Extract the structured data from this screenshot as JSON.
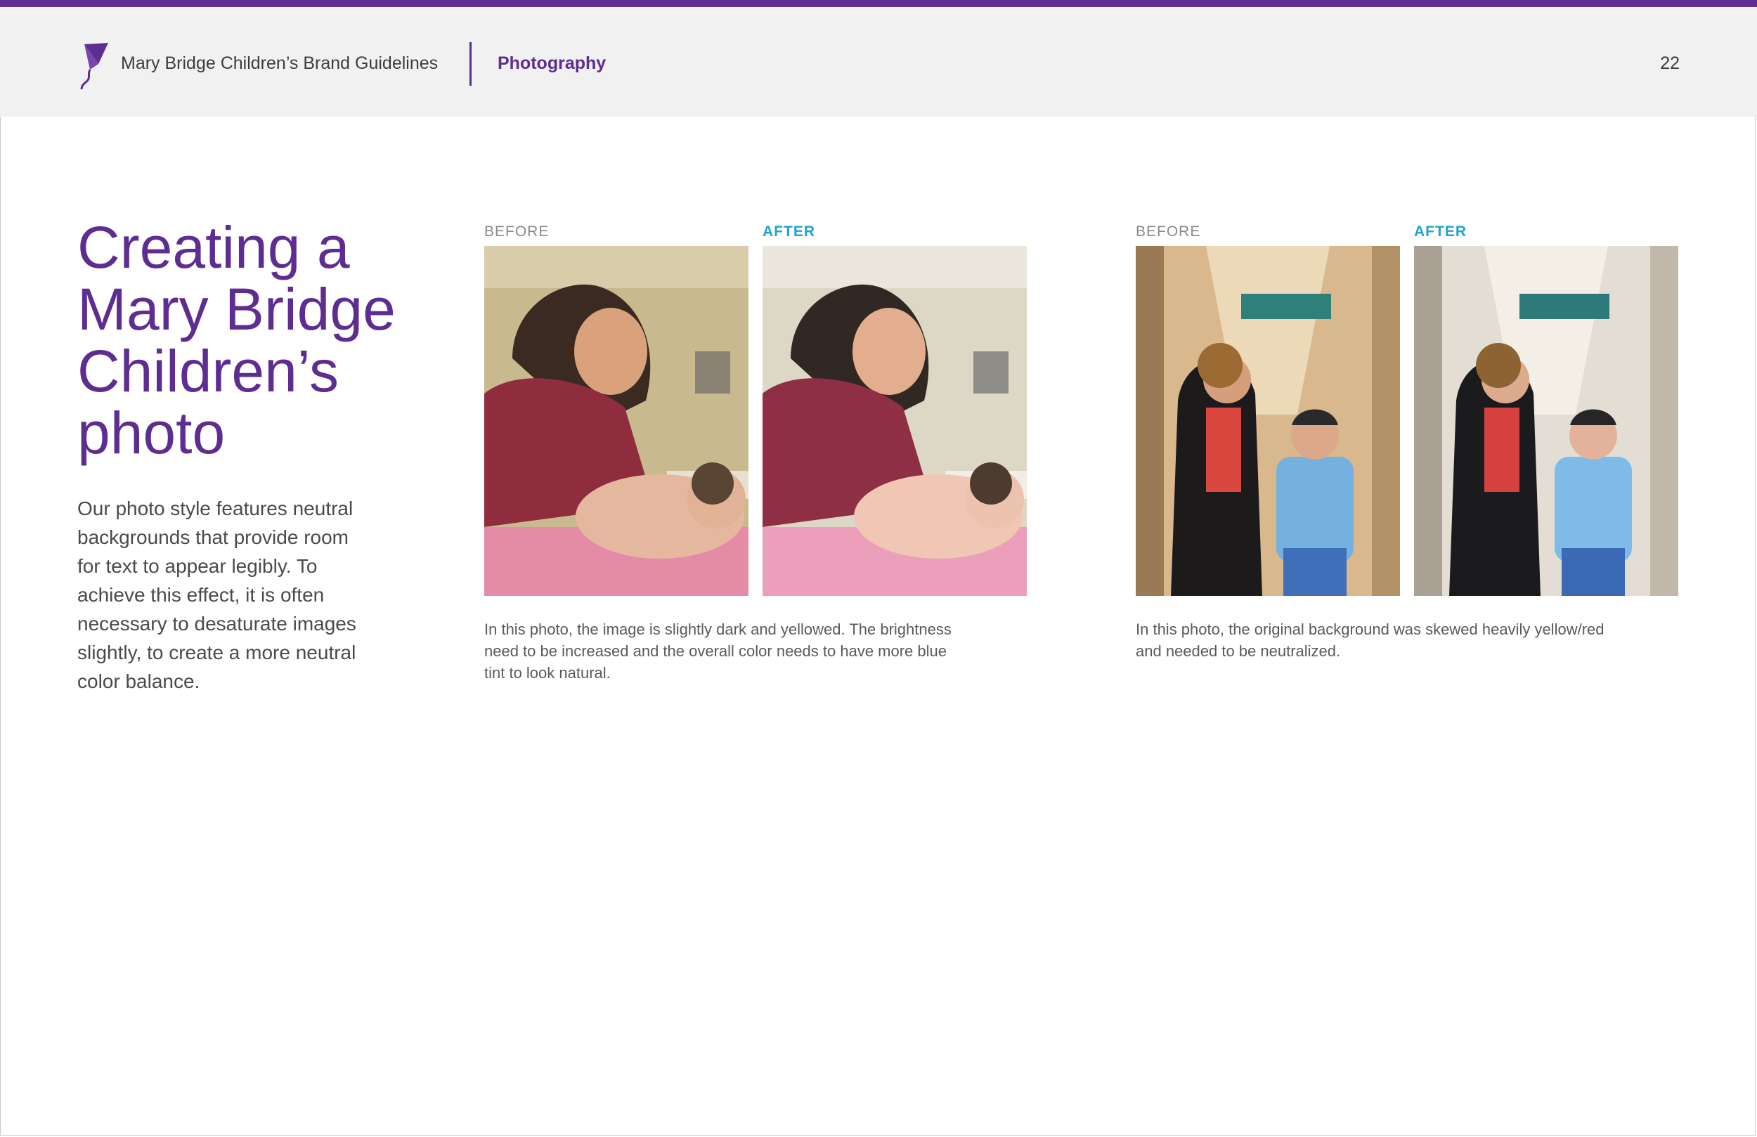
{
  "header": {
    "guide_title": "Mary Bridge Children’s Brand Guidelines",
    "section": "Photography",
    "page_number": "22"
  },
  "main": {
    "heading_lines": [
      "Creating a",
      "Mary Bridge",
      "Children’s",
      "photo"
    ],
    "intro_lines": [
      "Our photo style features neutral",
      "backgrounds that provide room",
      "for text to appear legibly. To",
      "achieve this effect, it is often",
      "necessary to desaturate images",
      "slightly, to create a more neutral",
      "color balance."
    ]
  },
  "example1": {
    "before_label": "BEFORE",
    "after_label": "AFTER",
    "caption_lines": [
      "In this photo, the image is slightly dark and yellowed. The brightness",
      "need to be increased and the overall color needs to have more blue",
      "tint to look natural."
    ]
  },
  "example2": {
    "before_label": "BEFORE",
    "after_label": "AFTER",
    "caption_lines": [
      "In this photo, the original background was skewed heavily yellow/red",
      "and needed to be neutralized."
    ]
  },
  "colors": {
    "brand_purple": "#5e2d91",
    "after_blue": "#1ea3cf",
    "header_bg": "#f1f1f1"
  }
}
